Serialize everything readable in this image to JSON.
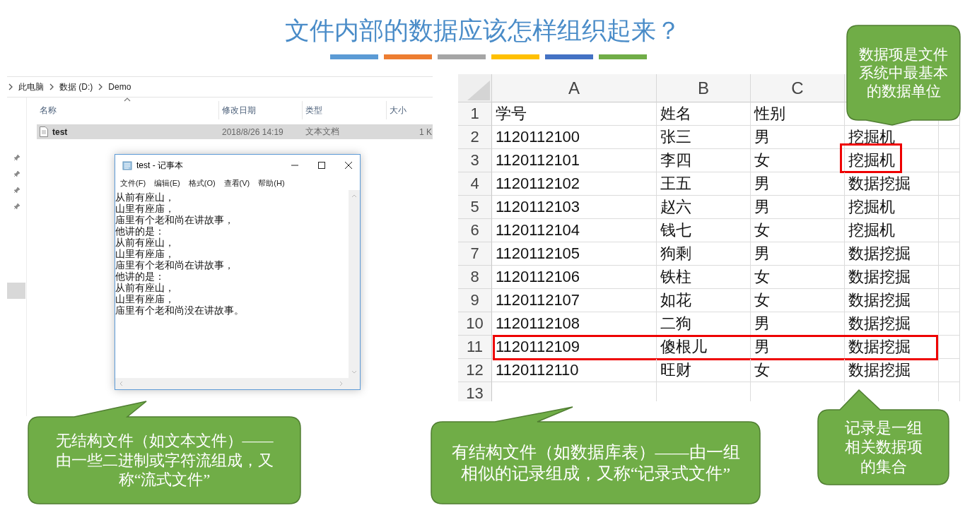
{
  "slide_title": "文件内部的数据应该怎样组织起来？",
  "accent_bars": [
    {
      "color": "#5b9bd5"
    },
    {
      "color": "#ed7d31"
    },
    {
      "color": "#a5a5a5"
    },
    {
      "color": "#ffc000"
    },
    {
      "color": "#4472c4"
    },
    {
      "color": "#70ad47"
    }
  ],
  "explorer": {
    "breadcrumb": [
      "此电脑",
      "数据 (D:)",
      "Demo"
    ],
    "columns": [
      "名称",
      "修改日期",
      "类型",
      "大小"
    ],
    "files": [
      {
        "name": "test",
        "modified": "2018/8/26 14:19",
        "type": "文本文档",
        "size": "1 K",
        "selected": true
      }
    ]
  },
  "notepad": {
    "title": "test - 记事本",
    "menu": [
      "文件(F)",
      "编辑(E)",
      "格式(O)",
      "查看(V)",
      "帮助(H)"
    ],
    "lines": [
      "从前有座山，",
      "山里有座庙，",
      "庙里有个老和尚在讲故事，",
      "他讲的是：",
      "从前有座山，",
      "山里有座庙，",
      "庙里有个老和尚在讲故事，",
      "他讲的是：",
      "从前有座山，",
      "山里有座庙，",
      "庙里有个老和尚没在讲故事。"
    ]
  },
  "spreadsheet": {
    "columns": [
      "A",
      "B",
      "C"
    ],
    "rows": [
      {
        "number": "1",
        "cells": [
          "学号",
          "姓名",
          "性别",
          ""
        ],
        "outlined": false,
        "last_cell_outlined": false
      },
      {
        "number": "2",
        "cells": [
          "1120112100",
          "张三",
          "男",
          "挖掘机"
        ],
        "outlined": false,
        "last_cell_outlined": false
      },
      {
        "number": "3",
        "cells": [
          "1120112101",
          "李四",
          "女",
          "挖掘机"
        ],
        "outlined": false,
        "last_cell_outlined": true
      },
      {
        "number": "4",
        "cells": [
          "1120112102",
          "王五",
          "男",
          "数据挖掘"
        ],
        "outlined": false,
        "last_cell_outlined": false
      },
      {
        "number": "5",
        "cells": [
          "1120112103",
          "赵六",
          "男",
          "挖掘机"
        ],
        "outlined": false,
        "last_cell_outlined": false
      },
      {
        "number": "6",
        "cells": [
          "1120112104",
          "钱七",
          "女",
          "挖掘机"
        ],
        "outlined": false,
        "last_cell_outlined": false
      },
      {
        "number": "7",
        "cells": [
          "1120112105",
          "狗剩",
          "男",
          "数据挖掘"
        ],
        "outlined": false,
        "last_cell_outlined": false
      },
      {
        "number": "8",
        "cells": [
          "1120112106",
          "铁柱",
          "女",
          "数据挖掘"
        ],
        "outlined": false,
        "last_cell_outlined": false
      },
      {
        "number": "9",
        "cells": [
          "1120112107",
          "如花",
          "女",
          "数据挖掘"
        ],
        "outlined": false,
        "last_cell_outlined": false
      },
      {
        "number": "10",
        "cells": [
          "1120112108",
          "二狗",
          "男",
          "数据挖掘"
        ],
        "outlined": false,
        "last_cell_outlined": false
      },
      {
        "number": "11",
        "cells": [
          "1120112109",
          "傻根儿",
          "男",
          "数据挖掘"
        ],
        "outlined": true,
        "last_cell_outlined": false
      },
      {
        "number": "12",
        "cells": [
          "1120112110",
          "旺财",
          "女",
          "数据挖掘"
        ],
        "outlined": false,
        "last_cell_outlined": false
      },
      {
        "number": "13",
        "cells": [
          "",
          "",
          "",
          ""
        ],
        "outlined": false,
        "last_cell_outlined": false
      }
    ]
  },
  "callouts": [
    {
      "text": "数据项是文件系统中最基本的数据单位"
    },
    {
      "text": "无结构文件（如文本文件）——由一些二进制或字符流组成，又称“流式文件”"
    },
    {
      "text": "有结构文件（如数据库表）——由一组相似的记录组成，又称“记录式文件”"
    },
    {
      "text": "记录是一组相关数据项的集合"
    }
  ]
}
